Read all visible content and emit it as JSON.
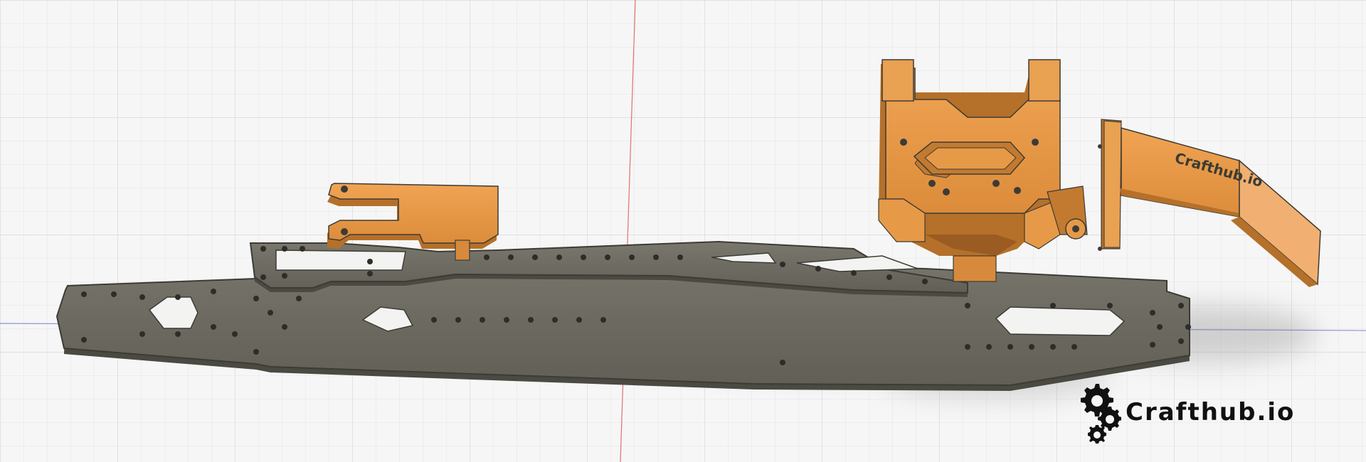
{
  "viewport": {
    "background": "#f6f6f6",
    "grid_minor_color": "#e4e4e4",
    "grid_major_color": "#d3d3d3",
    "axis_red_color": "#e07070",
    "axis_blue_color": "#8a90d8"
  },
  "parts": {
    "carbon_color": "#6e6d63",
    "carbon_edge_color": "#3c3b35",
    "orange_color": "#e69a48",
    "orange_dark_color": "#b5702a",
    "embossed_text": "Crafthub.io"
  },
  "watermark": {
    "icon": "gears-icon",
    "text": "Crafthub.io"
  }
}
